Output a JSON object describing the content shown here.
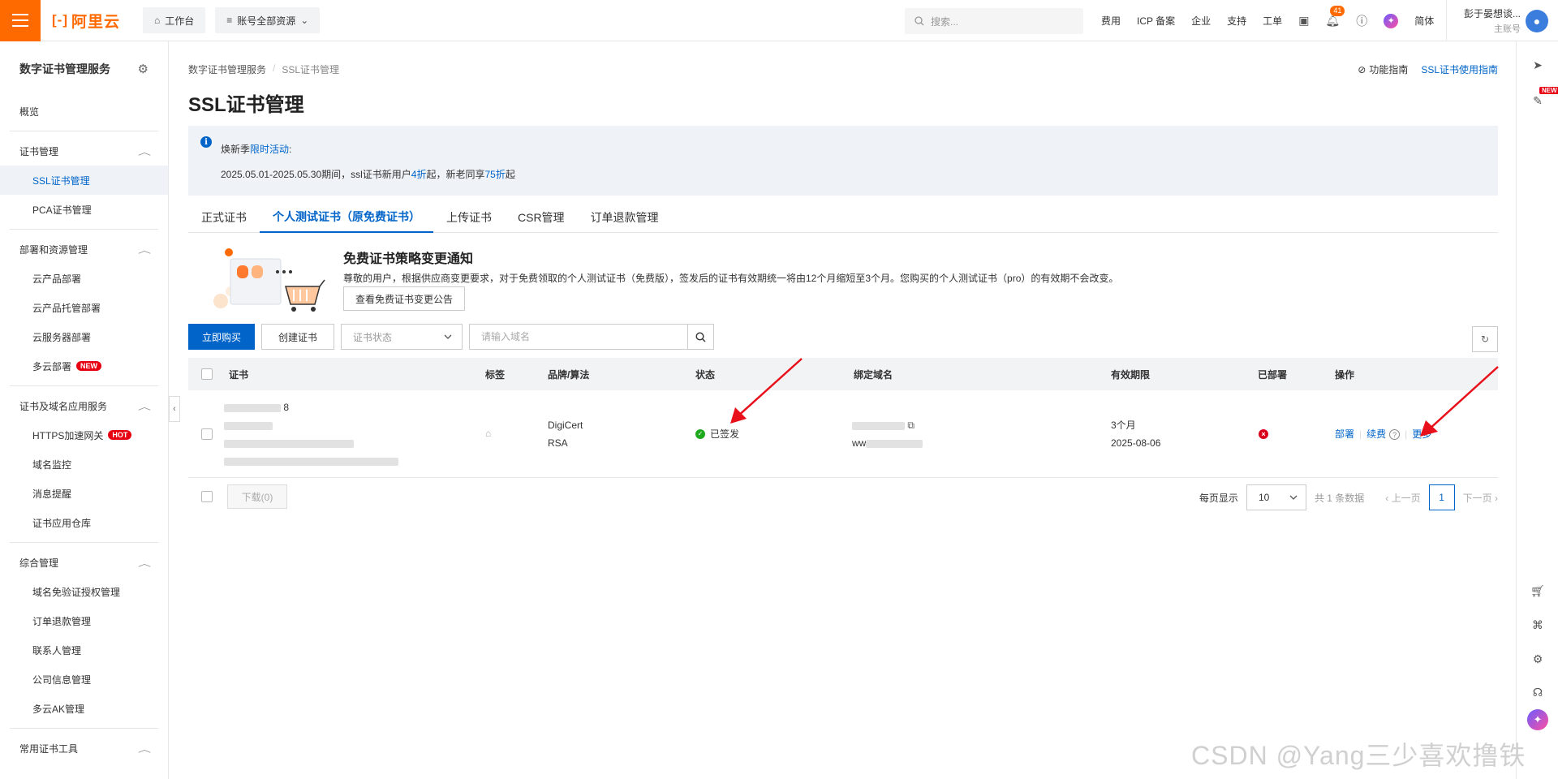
{
  "topbar": {
    "logo_text": "阿里云",
    "workbench": "工作台",
    "resources": "账号全部资源",
    "search_placeholder": "搜索...",
    "links": [
      "费用",
      "ICP 备案",
      "企业",
      "支持",
      "工单"
    ],
    "notification_count": "41",
    "language": "简体",
    "user_name": "彭于晏想谈...",
    "user_role": "主账号"
  },
  "sidebar": {
    "title": "数字证书管理服务",
    "overview": "概览",
    "groups": [
      {
        "label": "证书管理",
        "items": [
          "SSL证书管理",
          "PCA证书管理"
        ]
      },
      {
        "label": "部署和资源管理",
        "items": [
          "云产品部署",
          "云产品托管部署",
          "云服务器部署",
          "多云部署"
        ]
      },
      {
        "label": "证书及域名应用服务",
        "items": [
          "HTTPS加速网关",
          "域名监控",
          "消息提醒",
          "证书应用仓库"
        ]
      },
      {
        "label": "综合管理",
        "items": [
          "域名免验证授权管理",
          "订单退款管理",
          "联系人管理",
          "公司信息管理",
          "多云AK管理"
        ]
      },
      {
        "label": "常用证书工具",
        "items": []
      }
    ],
    "badge_new": "NEW",
    "badge_hot": "HOT"
  },
  "breadcrumb": {
    "root": "数字证书管理服务",
    "sep": "/",
    "current": "SSL证书管理"
  },
  "help": {
    "feature_guide": "功能指南",
    "ssl_guide": "SSL证书使用指南"
  },
  "page_title": "SSL证书管理",
  "notice": {
    "prefix": "焕新季",
    "link": "限时活动",
    "colon": ":",
    "line2_a": "2025.05.01-2025.05.30期间，ssl证书新用户",
    "line2_b": "4折",
    "line2_c": "起，新老同享",
    "line2_d": "75折",
    "line2_e": "起"
  },
  "tabs": [
    "正式证书",
    "个人测试证书（原免费证书）",
    "上传证书",
    "CSR管理",
    "订单退款管理"
  ],
  "promo": {
    "title": "免费证书策略变更通知",
    "desc": "尊敬的用户，根据供应商变更要求，对于免费领取的个人测试证书（免费版），签发后的证书有效期统一将由12个月缩短至3个月。您购买的个人测试证书（pro）的有效期不会改变。",
    "button": "查看免费证书变更公告"
  },
  "toolbar": {
    "buy": "立即购买",
    "create": "创建证书",
    "status_placeholder": "证书状态",
    "domain_placeholder": "请输入域名"
  },
  "table": {
    "headers": [
      "证书",
      "标签",
      "品牌/算法",
      "状态",
      "绑定域名",
      "有效期限",
      "已部署",
      "操作"
    ],
    "row": {
      "cert_suffix": "8",
      "brand": "DigiCert",
      "algo": "RSA",
      "status": "已签发",
      "domain_prefix": "ww",
      "validity": "3个月",
      "expire": "2025-08-06",
      "ops": [
        "部署",
        "续费",
        "更多"
      ]
    }
  },
  "footer": {
    "download": "下载(0)",
    "page_size_label": "每页显示",
    "page_size": "10",
    "total": "共 1 条数据",
    "prev": "上一页",
    "page": "1",
    "next": "下一页"
  },
  "watermark": "CSDN @Yang三少喜欢撸铁",
  "colors": {
    "brand": "#ff6a00",
    "primary": "#0064c8",
    "annotation_arrow": "#e8101a"
  }
}
